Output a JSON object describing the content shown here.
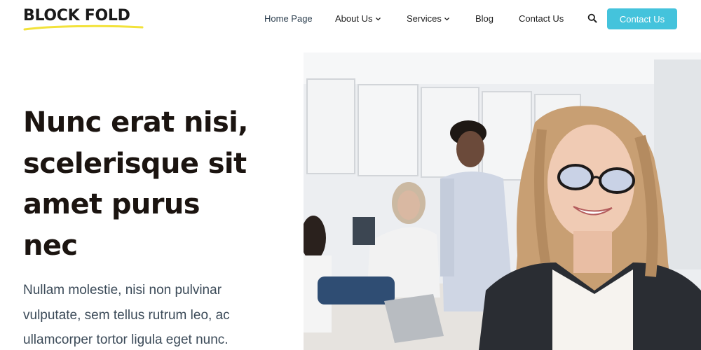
{
  "brand": {
    "logo_text": "BLOCK FOLD",
    "accent_underline": "#f2e23a"
  },
  "nav": {
    "items": [
      {
        "label": "Home Page",
        "active": true,
        "dropdown": false
      },
      {
        "label": "About Us",
        "active": false,
        "dropdown": true
      },
      {
        "label": "Services",
        "active": false,
        "dropdown": true
      },
      {
        "label": "Blog",
        "active": false,
        "dropdown": false
      },
      {
        "label": "Contact Us",
        "active": false,
        "dropdown": false
      }
    ],
    "search_icon": "search-icon",
    "cta_label": "Contact Us",
    "cta_color": "#44c3dc"
  },
  "hero": {
    "title_lines": [
      "Nunc erat nisi,",
      "scelerisque sit",
      "amet purus",
      "nec"
    ],
    "text_lines": [
      "Nullam molestie, nisi non pulvinar",
      "vulputate, sem tellus rutrum leo, ac",
      "ullamcorper tortor ligula eget nunc."
    ],
    "title_color": "#1b1410",
    "text_color": "#3b4a58"
  }
}
